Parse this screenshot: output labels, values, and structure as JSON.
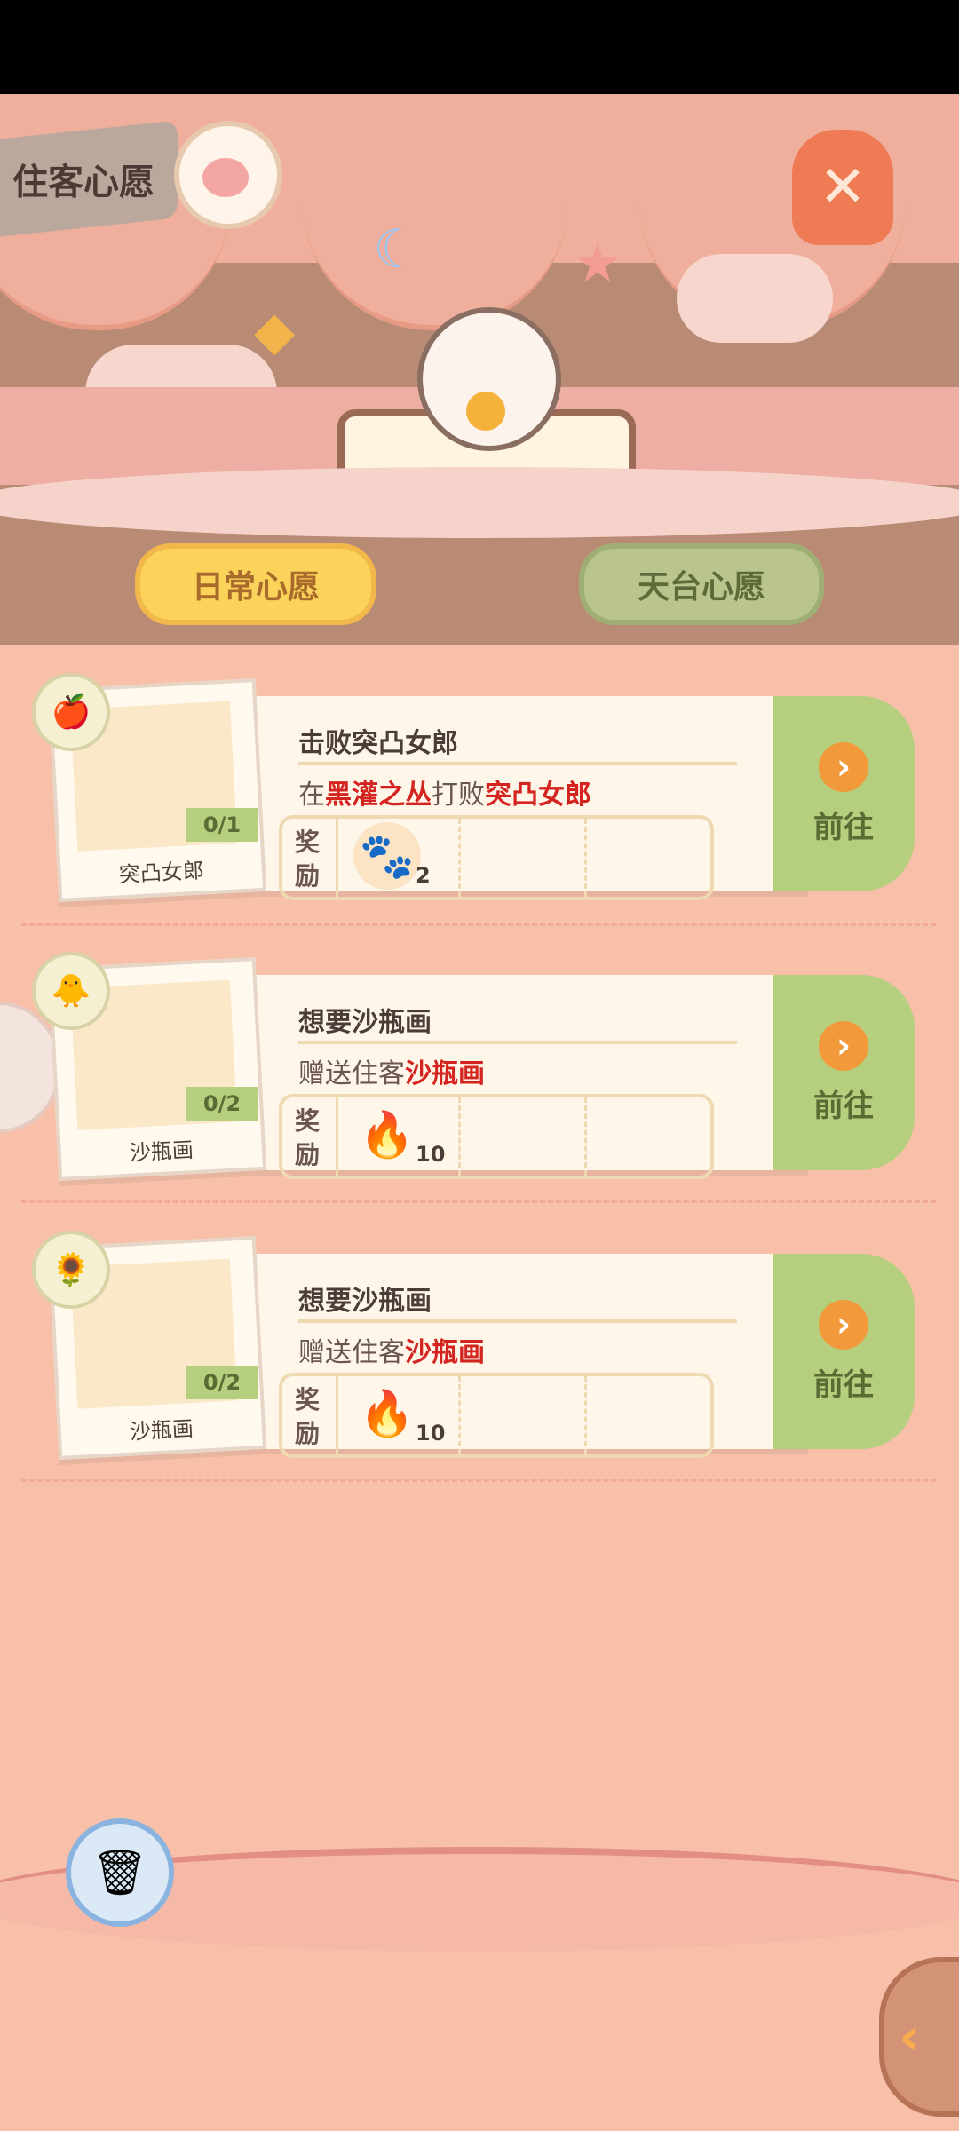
{
  "header": {
    "title": "住客心愿"
  },
  "tabs": [
    {
      "label": "日常心愿",
      "active": true
    },
    {
      "label": "天台心愿",
      "active": false
    }
  ],
  "tasks": [
    {
      "avatar_name": "突凸女郎",
      "progress": "0/1",
      "title": "击败突凸女郎",
      "desc_prefix": "在",
      "desc_hl1": "黑灌之丛",
      "desc_mid": "打败",
      "desc_hl2": "突凸女郎",
      "reward_label": "奖励",
      "reward_item": "paw-wand-icon",
      "reward_qty": "2",
      "goto_label": "前往"
    },
    {
      "avatar_name": "沙瓶画",
      "progress": "0/2",
      "title": "想要沙瓶画",
      "desc_prefix": "赠送住客",
      "desc_hl1": "沙瓶画",
      "reward_label": "奖励",
      "reward_item": "blue-flame-icon",
      "reward_qty": "10",
      "goto_label": "前往"
    },
    {
      "avatar_name": "沙瓶画",
      "progress": "0/2",
      "title": "想要沙瓶画",
      "desc_prefix": "赠送住客",
      "desc_hl1": "沙瓶画",
      "reward_label": "奖励",
      "reward_item": "blue-flame-icon",
      "reward_qty": "10",
      "goto_label": "前往"
    }
  ]
}
